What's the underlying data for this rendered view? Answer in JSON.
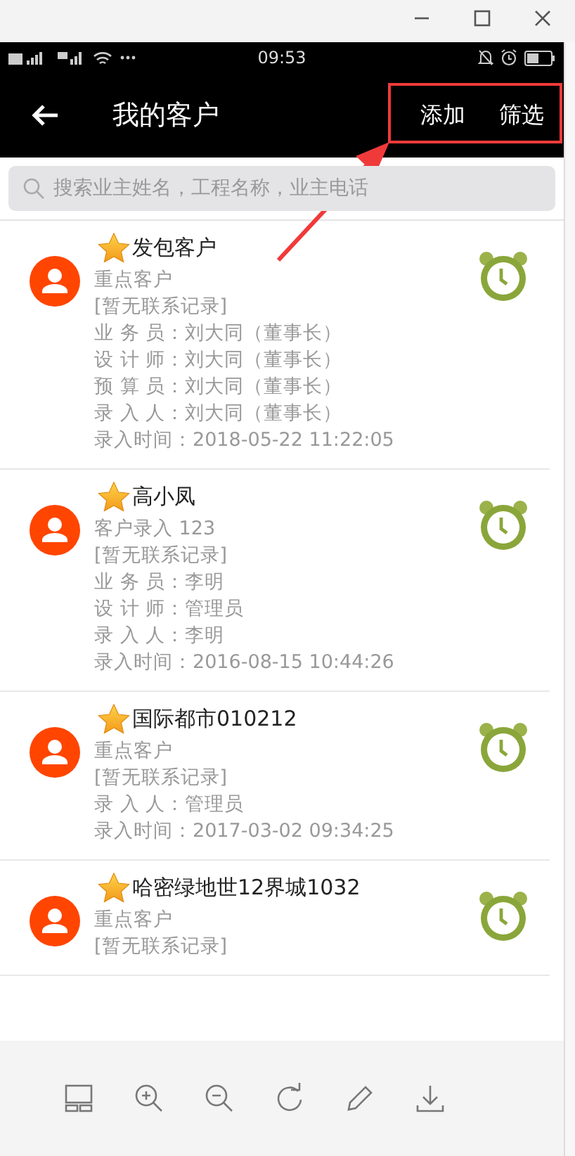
{
  "status_bar": {
    "time": "09:53"
  },
  "header": {
    "title": "我的客户",
    "actions": [
      "添加",
      "筛选"
    ]
  },
  "search": {
    "placeholder": "搜索业主姓名，工程名称，业主电话"
  },
  "customers": [
    {
      "name": "发包客户",
      "tag": "重点客户",
      "contact": "[暂无联系记录]",
      "details": [
        "业 务 员：刘大同（董事长）",
        "设 计 师：刘大同（董事长）",
        "预 算 员：刘大同（董事长）",
        "录 入 人：刘大同（董事长）",
        "录入时间：2018-05-22 11:22:05"
      ]
    },
    {
      "name": "高小凤",
      "tag": "客户录入   123",
      "contact": "[暂无联系记录]",
      "details": [
        "业 务 员：李明",
        "设 计 师：管理员",
        "录 入 人：李明",
        "录入时间：2016-08-15 10:44:26"
      ]
    },
    {
      "name": "国际都市010212",
      "tag": "重点客户",
      "contact": "[暂无联系记录]",
      "details": [
        "录 入 人：管理员",
        "录入时间：2017-03-02 09:34:25"
      ]
    },
    {
      "name": "哈密绿地世12界城1032",
      "tag": "重点客户",
      "contact": "[暂无联系记录]"
    }
  ]
}
